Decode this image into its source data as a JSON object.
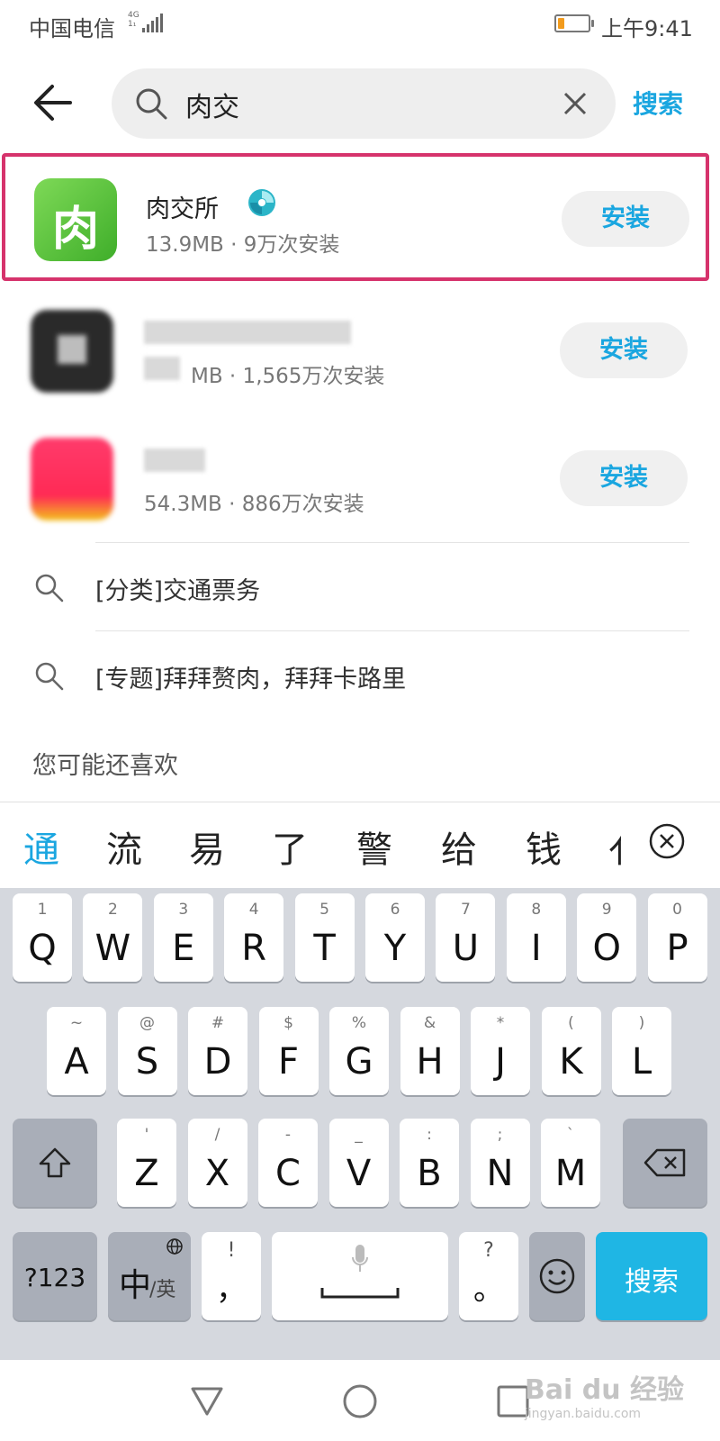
{
  "status": {
    "carrier": "中国电信",
    "network": "4G",
    "network_sub": "1₁",
    "time": "上午9:41",
    "battery_level": 0.22,
    "battery_color": "#f29b1d"
  },
  "search": {
    "query": "肉交",
    "action_label": "搜索"
  },
  "results": [
    {
      "name": "肉交所",
      "meta": "13.9MB · 9万次安装",
      "icon_char": "肉",
      "install_label": "安装",
      "verified": true
    },
    {
      "name": "",
      "meta": "MB · 1,565万次安装",
      "install_label": "安装",
      "verified": false
    },
    {
      "name": "",
      "meta": "54.3MB · 886万次安装",
      "install_label": "安装",
      "verified": false
    }
  ],
  "suggestions": [
    {
      "text": "[分类]交通票务",
      "icon": "search-icon"
    },
    {
      "text": "[专题]拜拜赘肉，拜拜卡路里",
      "icon": "search-icon"
    }
  ],
  "section_title": "您可能还喜欢",
  "ime": {
    "candidates": [
      "通",
      "流",
      "易",
      "了",
      "警",
      "给",
      "钱",
      "亻"
    ],
    "row1": [
      [
        "1",
        "Q"
      ],
      [
        "2",
        "W"
      ],
      [
        "3",
        "E"
      ],
      [
        "4",
        "R"
      ],
      [
        "5",
        "T"
      ],
      [
        "6",
        "Y"
      ],
      [
        "7",
        "U"
      ],
      [
        "8",
        "I"
      ],
      [
        "9",
        "O"
      ],
      [
        "0",
        "P"
      ]
    ],
    "row2": [
      [
        "~",
        "A"
      ],
      [
        "@",
        "S"
      ],
      [
        "#",
        "D"
      ],
      [
        "$",
        "F"
      ],
      [
        "%",
        "G"
      ],
      [
        "&",
        "H"
      ],
      [
        "*",
        "J"
      ],
      [
        "(",
        "K"
      ],
      [
        ")",
        "L"
      ]
    ],
    "row3": [
      [
        "'",
        "Z"
      ],
      [
        "/",
        "X"
      ],
      [
        "-",
        "C"
      ],
      [
        "_",
        "V"
      ],
      [
        ":",
        "B"
      ],
      [
        ";",
        "N"
      ],
      [
        "`",
        "M"
      ]
    ],
    "sym_key": "?123",
    "lang_key": "中",
    "lang_sub": "/英",
    "comma_hint": "!",
    "comma": "，",
    "period_hint": "?",
    "period": "。",
    "enter_label": "搜索"
  },
  "watermark": {
    "text": "Bai du 经验",
    "sub": "jingyan.baidu.com"
  },
  "colors": {
    "accent": "#1aa6e0",
    "highlight": "#d6336c",
    "enter_key": "#1fb6e4"
  }
}
